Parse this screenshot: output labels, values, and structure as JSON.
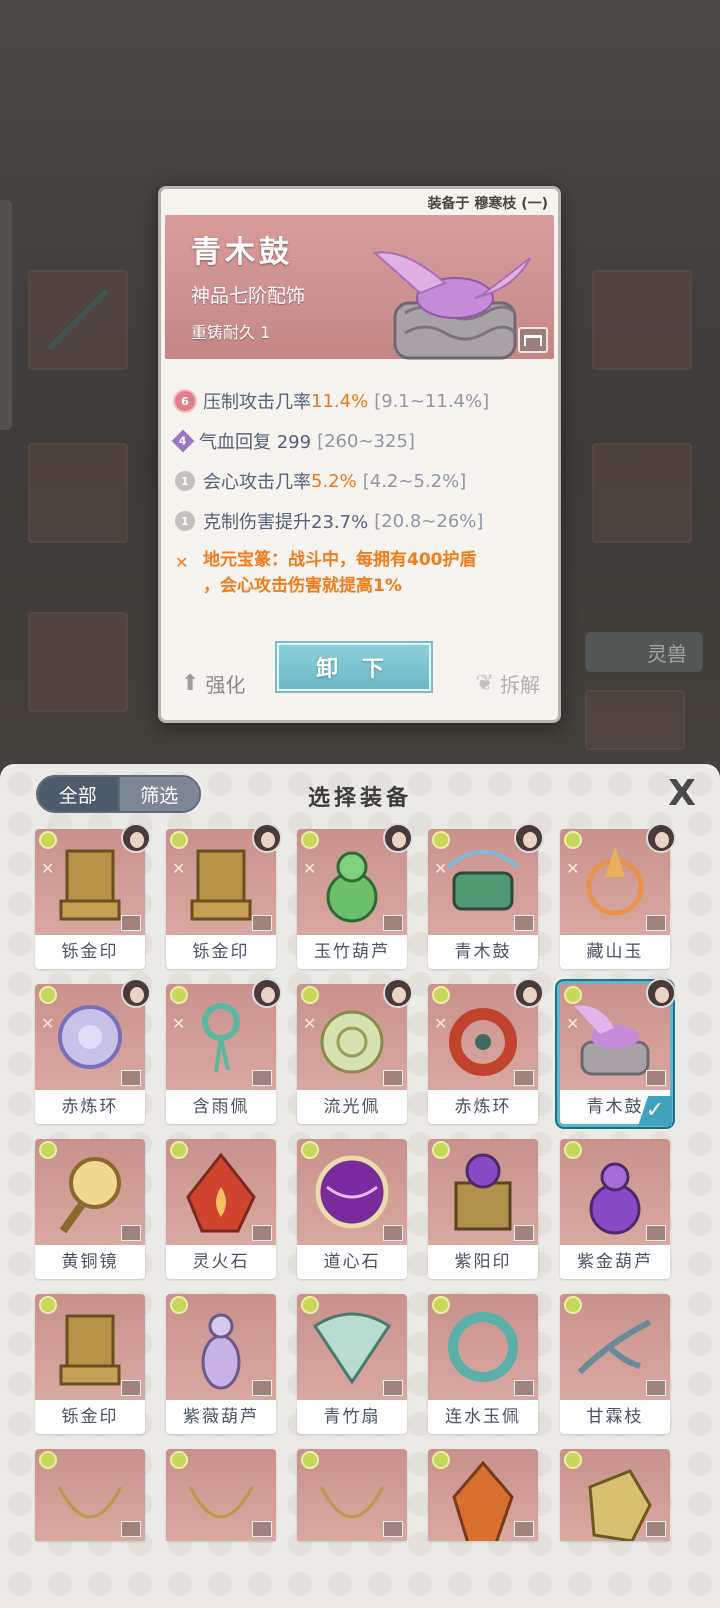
{
  "card": {
    "equipped_on": "装备于 穆寒枝 (一)",
    "name": "青木鼓",
    "grade": "神品七阶配饰",
    "recast": "重铸耐久 1",
    "stats": [
      {
        "badge": "6",
        "badge_color": "red",
        "label": "压制攻击几率 ",
        "value": "11.4%",
        "highlight": true,
        "range": "[9.1~11.4%]"
      },
      {
        "badge": "4",
        "badge_color": "purple",
        "label": "气血回复 299",
        "value": "",
        "highlight": false,
        "range": "[260~325]"
      },
      {
        "badge": "1",
        "badge_color": "grey",
        "label": "会心攻击几率 ",
        "value": "5.2%",
        "highlight": true,
        "range": "[4.2~5.2%]"
      },
      {
        "badge": "1",
        "badge_color": "grey",
        "label": "克制伤害提升23.7%",
        "value": "",
        "highlight": false,
        "range": "[20.8~26%]"
      }
    ],
    "effect_line1": "地元宝篆：战斗中，每拥有400护盾",
    "effect_line2": "，会心攻击伤害就提高1%",
    "enhance_label": "强化",
    "unequip_label": "卸 下",
    "disassemble_label": "拆解"
  },
  "background": {
    "tab_label": "灵兽"
  },
  "panel": {
    "title": "选择装备",
    "close": "X",
    "filter_all": "全部",
    "filter_screen": "筛选",
    "items": [
      {
        "name": "铄金印",
        "art": "seal-gold"
      },
      {
        "name": "铄金印",
        "art": "seal-gold"
      },
      {
        "name": "玉竹葫芦",
        "art": "gourd-green"
      },
      {
        "name": "青木鼓",
        "art": "drum"
      },
      {
        "name": "藏山玉",
        "art": "jade-orange"
      },
      {
        "name": "赤炼环",
        "art": "ring-purple"
      },
      {
        "name": "含雨佩",
        "art": "pendant-teal"
      },
      {
        "name": "流光佩",
        "art": "disc-jade"
      },
      {
        "name": "赤炼环",
        "art": "ring-red"
      },
      {
        "name": "青木鼓",
        "art": "cicada",
        "selected": true
      },
      {
        "name": "黄铜镜",
        "art": "mirror"
      },
      {
        "name": "灵火石",
        "art": "fire-stone"
      },
      {
        "name": "道心石",
        "art": "orb-purple"
      },
      {
        "name": "紫阳印",
        "art": "seal-purple"
      },
      {
        "name": "紫金葫芦",
        "art": "gourd-purple"
      },
      {
        "name": "铄金印",
        "art": "seal-gold"
      },
      {
        "name": "紫薇葫芦",
        "art": "gourd-lilac"
      },
      {
        "name": "青竹扇",
        "art": "fan"
      },
      {
        "name": "连水玉佩",
        "art": "ring-teal"
      },
      {
        "name": "甘霖枝",
        "art": "branch"
      },
      {
        "name": "",
        "art": "crescent-green"
      },
      {
        "name": "",
        "art": "crescent-green"
      },
      {
        "name": "",
        "art": "crescent-green"
      },
      {
        "name": "",
        "art": "crystal-red"
      },
      {
        "name": "",
        "art": "rock-gold"
      }
    ]
  }
}
